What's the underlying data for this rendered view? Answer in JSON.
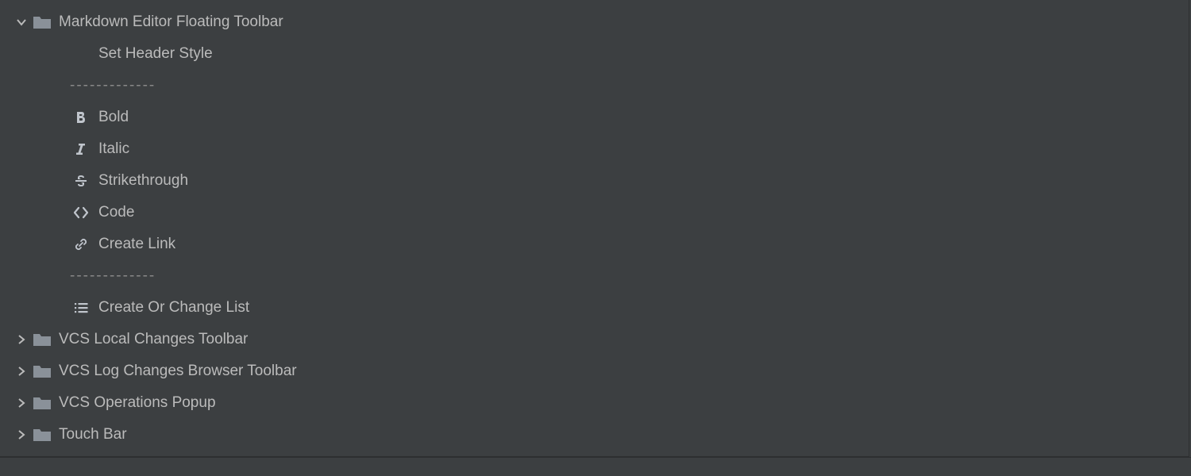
{
  "separator_text": "-------------",
  "folder_expanded": {
    "label": "Markdown Editor Floating Toolbar",
    "items": [
      {
        "label": "Set Header Style",
        "icon": null
      },
      {
        "label": "Bold",
        "icon": "bold"
      },
      {
        "label": "Italic",
        "icon": "italic"
      },
      {
        "label": "Strikethrough",
        "icon": "strikethrough"
      },
      {
        "label": "Code",
        "icon": "code"
      },
      {
        "label": "Create Link",
        "icon": "link"
      },
      {
        "label": "Create Or Change List",
        "icon": "list"
      }
    ]
  },
  "folders_collapsed": [
    {
      "label": "VCS Local Changes Toolbar"
    },
    {
      "label": "VCS Log Changes Browser Toolbar"
    },
    {
      "label": "VCS Operations Popup"
    },
    {
      "label": "Touch Bar"
    }
  ]
}
